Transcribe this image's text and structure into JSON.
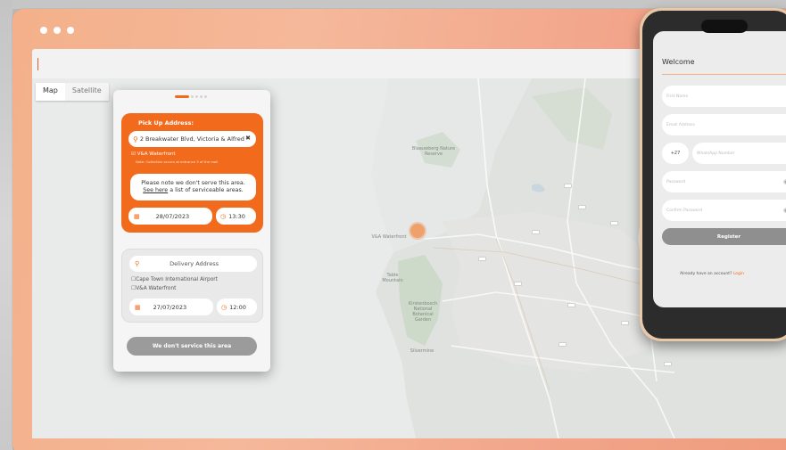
{
  "browser": {
    "url": ""
  },
  "map": {
    "type_options": [
      "Map",
      "Satellite"
    ],
    "selected_type": "Map",
    "labels": {
      "blaauwberg": "Blaauwberg Nature Reserve",
      "waterfront": "V&A Waterfront",
      "table_mountain": "Table Mountain",
      "kirstenbosch": "Kirstenbosch National Botanical Garden",
      "silvermine": "Silvermine"
    }
  },
  "booking": {
    "pickup": {
      "title": "Pick Up Address:",
      "address_value": "2 Breakwater Blvd, Victoria & Alfred Waterfront",
      "location_checked": "V&A Waterfront",
      "note": "Note: Collection occurs at entrance 3 of the mall",
      "warning_line1": "Please note we don't serve this area.",
      "warning_link": "See here",
      "warning_line2": "a list of serviceable areas.",
      "date": "28/07/2023",
      "time": "13:30"
    },
    "delivery": {
      "address_placeholder": "Delivery Address",
      "options": [
        "Cape Town International Airport",
        "V&A Waterfront"
      ],
      "date": "27/07/2023",
      "time": "12:00"
    },
    "cta_label": "We don't service this area"
  },
  "phone": {
    "title": "Welcome",
    "fields": {
      "first_name": "First Name",
      "email": "Email Address",
      "country_code": "+27",
      "whatsapp": "WhatsApp Number",
      "password": "Password",
      "confirm_password": "Confirm Password"
    },
    "register_label": "Register",
    "login_prompt": "Already have an account?",
    "login_link": "Login"
  },
  "colors": {
    "accent": "#f26b1d",
    "frame": "#f3b08a",
    "button_disabled": "#9b9b9b"
  },
  "icons": [
    "search-icon",
    "close-icon",
    "calendar-icon",
    "clock-icon",
    "eye-icon",
    "map-pin-icon",
    "checkbox-icon"
  ]
}
